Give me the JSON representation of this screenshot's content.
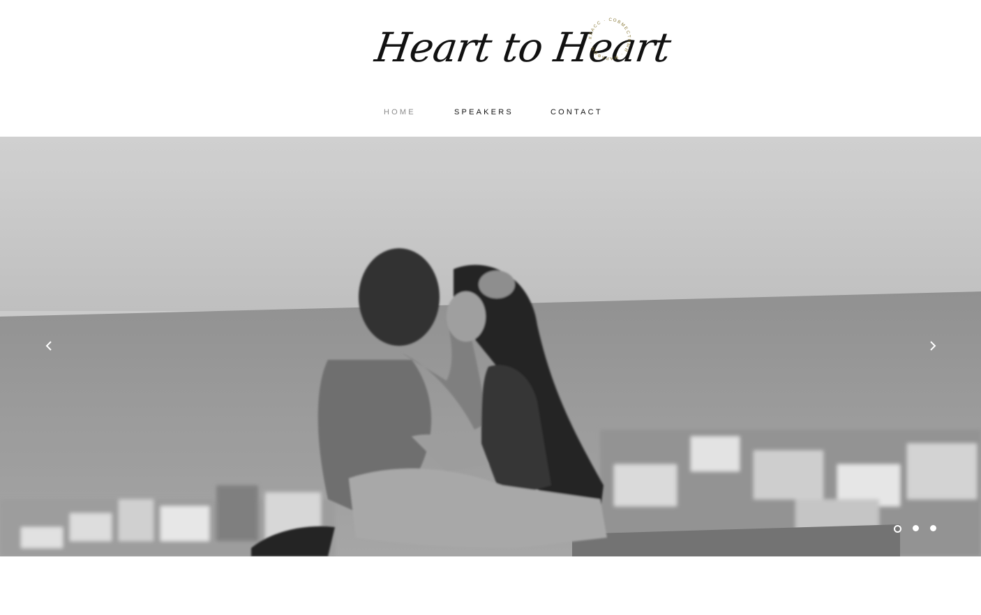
{
  "brand": {
    "logo_text": "Heart to Heart",
    "seal_text": "КЛАСС · СОВМЕСТНЫЙ · МАРАФОН ·",
    "seal_color": "#8a7a3a"
  },
  "nav": {
    "items": [
      {
        "label": "HOME",
        "active": true
      },
      {
        "label": "SPEAKERS",
        "active": false
      },
      {
        "label": "CONTACT",
        "active": false
      }
    ]
  },
  "slider": {
    "image_icon": "hero-photo",
    "prev_icon": "chevron-left-icon",
    "next_icon": "chevron-right-icon",
    "slide_count": 3,
    "active_slide": 1
  },
  "colors": {
    "text": "#111111",
    "nav_active": "#8a8a8a",
    "background": "#ffffff"
  }
}
